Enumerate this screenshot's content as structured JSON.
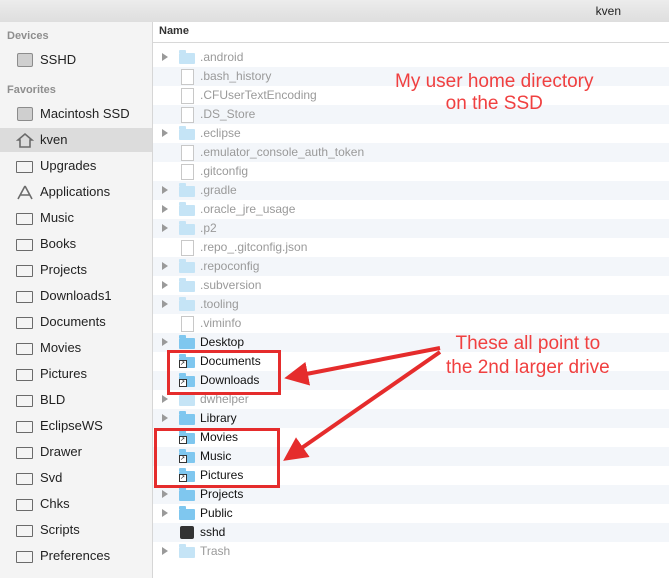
{
  "titlebar": {
    "user": "kven"
  },
  "sidebar": {
    "devices_header": "Devices",
    "devices": [
      {
        "label": "SSHD",
        "icon": "disk-icon"
      }
    ],
    "favorites_header": "Favorites",
    "favorites": [
      {
        "label": "Macintosh SSD",
        "icon": "disk-icon"
      },
      {
        "label": "kven",
        "icon": "home-icon",
        "selected": true
      },
      {
        "label": "Upgrades",
        "icon": "folder-icon"
      },
      {
        "label": "Applications",
        "icon": "applications-icon"
      },
      {
        "label": "Music",
        "icon": "folder-icon"
      },
      {
        "label": "Books",
        "icon": "folder-icon"
      },
      {
        "label": "Projects",
        "icon": "folder-icon"
      },
      {
        "label": "Downloads1",
        "icon": "folder-icon"
      },
      {
        "label": "Documents",
        "icon": "folder-icon"
      },
      {
        "label": "Movies",
        "icon": "folder-icon"
      },
      {
        "label": "Pictures",
        "icon": "folder-icon"
      },
      {
        "label": "BLD",
        "icon": "folder-icon"
      },
      {
        "label": "EclipseWS",
        "icon": "folder-icon"
      },
      {
        "label": "Drawer",
        "icon": "folder-icon"
      },
      {
        "label": "Svd",
        "icon": "folder-icon"
      },
      {
        "label": "Chks",
        "icon": "folder-icon"
      },
      {
        "label": "Scripts",
        "icon": "folder-icon"
      },
      {
        "label": "Preferences",
        "icon": "folder-icon"
      }
    ]
  },
  "list": {
    "column_name": "Name",
    "rows": [
      {
        "name": ".android",
        "kind": "folder",
        "hidden": true,
        "expandable": true
      },
      {
        "name": ".bash_history",
        "kind": "file",
        "hidden": true
      },
      {
        "name": ".CFUserTextEncoding",
        "kind": "file",
        "hidden": true
      },
      {
        "name": ".DS_Store",
        "kind": "file",
        "hidden": true
      },
      {
        "name": ".eclipse",
        "kind": "folder",
        "hidden": true,
        "expandable": true
      },
      {
        "name": ".emulator_console_auth_token",
        "kind": "file",
        "hidden": true
      },
      {
        "name": ".gitconfig",
        "kind": "file",
        "hidden": true
      },
      {
        "name": ".gradle",
        "kind": "folder",
        "hidden": true,
        "expandable": true
      },
      {
        "name": ".oracle_jre_usage",
        "kind": "folder",
        "hidden": true,
        "expandable": true
      },
      {
        "name": ".p2",
        "kind": "folder",
        "hidden": true,
        "expandable": true
      },
      {
        "name": ".repo_.gitconfig.json",
        "kind": "file",
        "hidden": true
      },
      {
        "name": ".repoconfig",
        "kind": "folder",
        "hidden": true,
        "expandable": true
      },
      {
        "name": ".subversion",
        "kind": "folder",
        "hidden": true,
        "expandable": true
      },
      {
        "name": ".tooling",
        "kind": "folder",
        "hidden": true,
        "expandable": true
      },
      {
        "name": ".viminfo",
        "kind": "file",
        "hidden": true
      },
      {
        "name": "Desktop",
        "kind": "folder",
        "hidden": false,
        "expandable": true
      },
      {
        "name": "Documents",
        "kind": "alias",
        "hidden": false
      },
      {
        "name": "Downloads",
        "kind": "alias",
        "hidden": false
      },
      {
        "name": "dwhelper",
        "kind": "folder",
        "hidden": true,
        "expandable": true
      },
      {
        "name": "Library",
        "kind": "folder",
        "hidden": false,
        "expandable": true
      },
      {
        "name": "Movies",
        "kind": "alias",
        "hidden": false
      },
      {
        "name": "Music",
        "kind": "alias",
        "hidden": false
      },
      {
        "name": "Pictures",
        "kind": "alias",
        "hidden": false
      },
      {
        "name": "Projects",
        "kind": "folder",
        "hidden": false,
        "expandable": true
      },
      {
        "name": "Public",
        "kind": "folder",
        "hidden": false,
        "expandable": true
      },
      {
        "name": "sshd",
        "kind": "exec",
        "hidden": false
      },
      {
        "name": "Trash",
        "kind": "folder",
        "hidden": true,
        "expandable": true
      }
    ]
  },
  "annotations": {
    "home_note_line1": "My user home directory",
    "home_note_line2": "on the SSD",
    "point_note_line1": "These all point to",
    "point_note_line2": "the 2nd larger drive",
    "color": "#f04040"
  }
}
